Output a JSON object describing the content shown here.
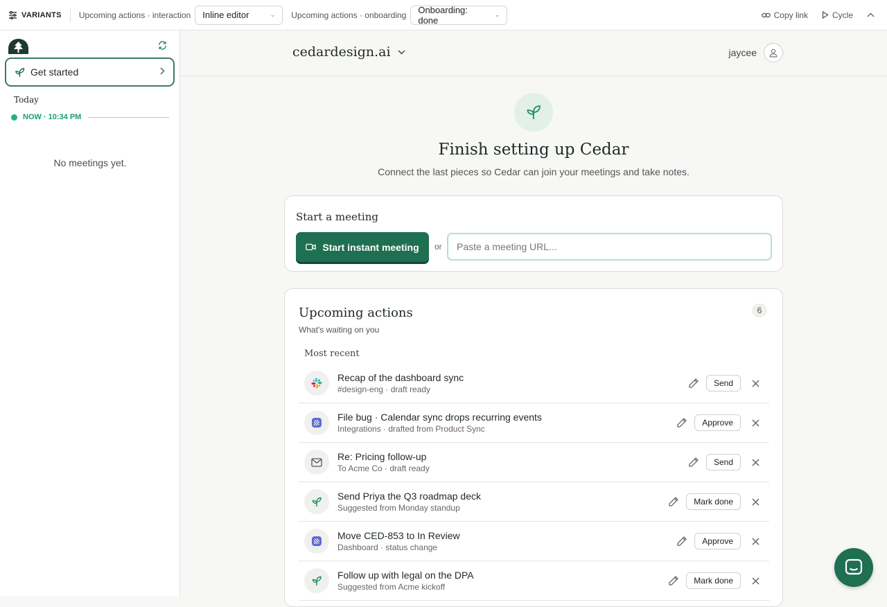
{
  "variants_bar": {
    "brand": "VARIANTS",
    "interaction_label": "Upcoming actions · interaction",
    "interaction_value": "Inline editor",
    "onboarding_label": "Upcoming actions · onboarding",
    "onboarding_value": "Onboarding: done",
    "copy_link": "Copy link",
    "cycle": "Cycle"
  },
  "sidebar": {
    "get_started": "Get started",
    "today": "Today",
    "now": "NOW · 10:34 PM",
    "empty": "No meetings yet."
  },
  "header": {
    "workspace": "cedardesign.ai",
    "user": "jaycee"
  },
  "hero": {
    "title": "Finish setting up Cedar",
    "subtitle": "Connect the last pieces so Cedar can join your meetings and take notes."
  },
  "start_meeting": {
    "title": "Start a meeting",
    "button": "Start instant meeting",
    "or": "or",
    "url_placeholder": "Paste a meeting URL..."
  },
  "upcoming": {
    "title": "Upcoming actions",
    "count": "6",
    "subtitle": "What's waiting on you",
    "section": "Most recent",
    "items": [
      {
        "icon": "slack-icon",
        "title": "Recap of the dashboard sync",
        "meta": "#design-eng · draft ready",
        "action": "Send"
      },
      {
        "icon": "linear-icon",
        "title": "File bug · Calendar sync drops recurring events",
        "meta": "Integrations · drafted from Product Sync",
        "action": "Approve"
      },
      {
        "icon": "mail-icon",
        "title": "Re: Pricing follow-up",
        "meta": "To Acme Co · draft ready",
        "action": "Send"
      },
      {
        "icon": "sprout-icon",
        "title": "Send Priya the Q3 roadmap deck",
        "meta": "Suggested from Monday standup",
        "action": "Mark done"
      },
      {
        "icon": "linear-icon",
        "title": "Move CED-853 to In Review",
        "meta": "Dashboard · status change",
        "action": "Approve"
      },
      {
        "icon": "sprout-icon",
        "title": "Follow up with legal on the DPA",
        "meta": "Suggested from Acme kickoff",
        "action": "Mark done"
      }
    ]
  },
  "colors": {
    "brand_green": "#1f6f52",
    "accent_green": "#1fb57a",
    "linear_purple": "#5e6ad2"
  }
}
